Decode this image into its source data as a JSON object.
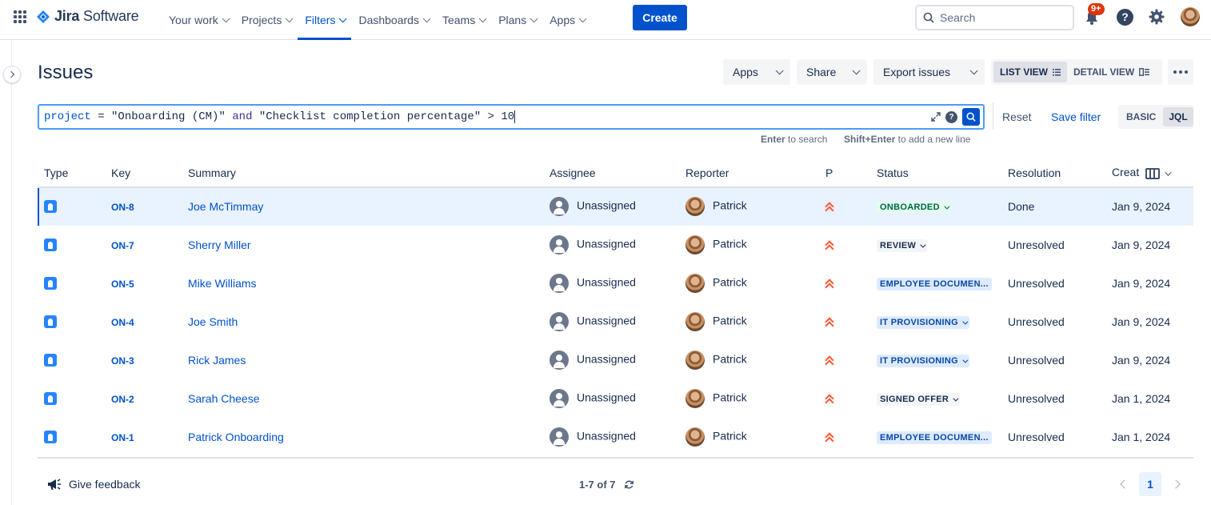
{
  "app": {
    "name_a": "Jira",
    "name_b": " Software"
  },
  "nav": [
    {
      "label": "Your work"
    },
    {
      "label": "Projects"
    },
    {
      "label": "Filters",
      "active": true
    },
    {
      "label": "Dashboards"
    },
    {
      "label": "Teams"
    },
    {
      "label": "Plans"
    },
    {
      "label": "Apps"
    }
  ],
  "create_label": "Create",
  "search": {
    "placeholder": "Search"
  },
  "notifications": {
    "badge": "9+"
  },
  "help_glyph": "?",
  "page": {
    "title": "Issues"
  },
  "toolbar": {
    "apps": "Apps",
    "share": "Share",
    "export": "Export issues",
    "list_view": "LIST VIEW",
    "detail_view": "DETAIL VIEW"
  },
  "jql": {
    "kw1": "project",
    "op1": " = ",
    "str1": "\"Onboarding (CM)\"",
    "and": " and ",
    "str2": "\"Checklist completion percentage\"",
    "op2": " > ",
    "num": "10",
    "help_glyph": "?"
  },
  "hint": {
    "enter": "Enter",
    "enter_text": " to search",
    "shift": "Shift+Enter",
    "shift_text": " to add a new line"
  },
  "reset_label": "Reset",
  "save_filter_label": "Save filter",
  "mode": {
    "basic": "BASIC",
    "jql": "JQL"
  },
  "columns": [
    "Type",
    "Key",
    "Summary",
    "Assignee",
    "Reporter",
    "P",
    "Status",
    "Resolution",
    "Creat"
  ],
  "rows": [
    {
      "key": "ON-8",
      "summary": "Joe McTimmay",
      "assignee": "Unassigned",
      "reporter": "Patrick",
      "status": "ONBOARDED",
      "resolution": "Done",
      "created": "Jan 9, 2024"
    },
    {
      "key": "ON-7",
      "summary": "Sherry Miller",
      "assignee": "Unassigned",
      "reporter": "Patrick",
      "status": "REVIEW",
      "resolution": "Unresolved",
      "created": "Jan 9, 2024"
    },
    {
      "key": "ON-5",
      "summary": "Mike Williams",
      "assignee": "Unassigned",
      "reporter": "Patrick",
      "status": "EMPLOYEE DOCUMEN...",
      "resolution": "Unresolved",
      "created": "Jan 9, 2024"
    },
    {
      "key": "ON-4",
      "summary": "Joe Smith",
      "assignee": "Unassigned",
      "reporter": "Patrick",
      "status": "IT PROVISIONING",
      "resolution": "Unresolved",
      "created": "Jan 9, 2024"
    },
    {
      "key": "ON-3",
      "summary": "Rick James",
      "assignee": "Unassigned",
      "reporter": "Patrick",
      "status": "IT PROVISIONING",
      "resolution": "Unresolved",
      "created": "Jan 9, 2024"
    },
    {
      "key": "ON-2",
      "summary": "Sarah Cheese",
      "assignee": "Unassigned",
      "reporter": "Patrick",
      "status": "SIGNED OFFER",
      "resolution": "Unresolved",
      "created": "Jan 1, 2024"
    },
    {
      "key": "ON-1",
      "summary": "Patrick Onboarding",
      "assignee": "Unassigned",
      "reporter": "Patrick",
      "status": "EMPLOYEE DOCUMEN...",
      "resolution": "Unresolved",
      "created": "Jan 1, 2024"
    }
  ],
  "footer": {
    "feedback": "Give feedback",
    "count": "1-7 of 7",
    "page": "1"
  },
  "colors": {
    "accent": "#0052cc",
    "status_green": "#006644",
    "status_blue": "#0747a6",
    "priority": "#ff5630",
    "selected_row": "#e9f2ff"
  }
}
